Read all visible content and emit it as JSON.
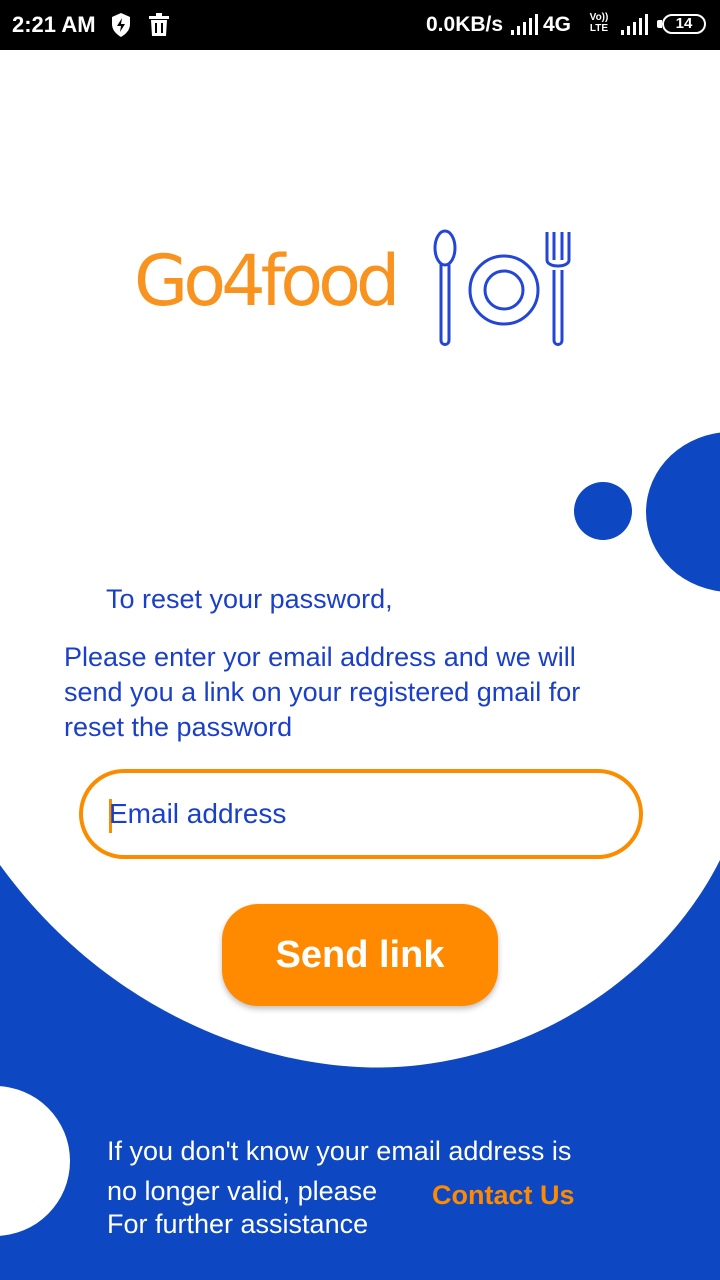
{
  "status_bar": {
    "time": "2:21 AM",
    "net_speed": "0.0KB/s",
    "net_type": "4G",
    "volte_top": "Vo))",
    "volte_bottom": "LTE",
    "battery": "14",
    "icons": [
      "shield-bolt-icon",
      "trash-icon",
      "signal-icon",
      "signal-icon-2"
    ]
  },
  "logo": {
    "text": "Go4food",
    "icon": "cutlery-plate-icon"
  },
  "reset": {
    "heading": "To reset your password,",
    "description": "Please enter yor email  address and we will send you a link on your registered gmail for reset the password"
  },
  "email": {
    "placeholder": "Email address",
    "value": ""
  },
  "send_button": {
    "label": "Send link"
  },
  "footer": {
    "line1": "If you don't know your email address is",
    "line2": "no longer valid, please",
    "line3": "For further assistance",
    "contact_label": "Contact Us"
  },
  "colors": {
    "accent_orange": "#ff8a00",
    "brand_blue": "#0d47c1",
    "text_blue": "#1a3fc9"
  }
}
